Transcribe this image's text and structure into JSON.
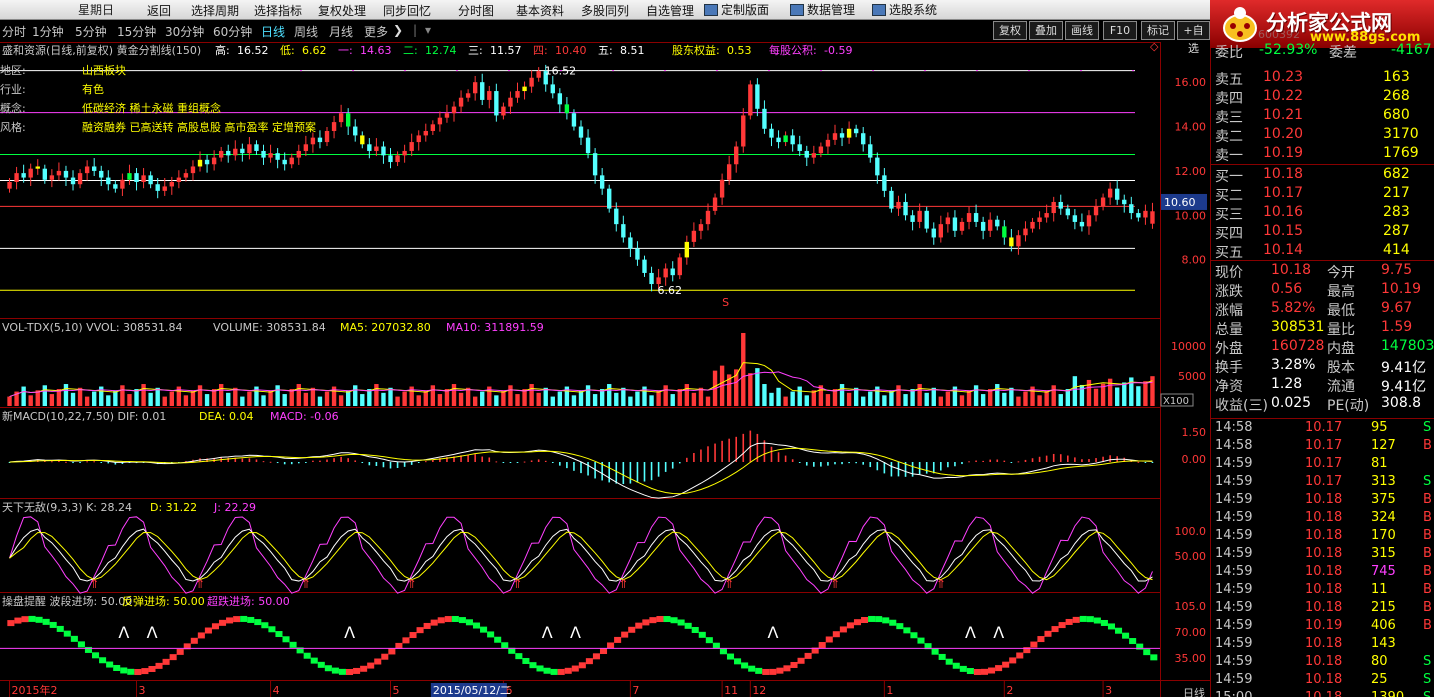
{
  "titlebar": {
    "weekday": "星期日",
    "items": [
      {
        "label": "定制版面",
        "icon": "layout-icon"
      },
      {
        "label": "数据管理",
        "icon": "database-icon"
      },
      {
        "label": "选股系统",
        "icon": "stock-picker-icon"
      }
    ]
  },
  "period_tabs": [
    "分时",
    "1分钟",
    "5分钟",
    "15分钟",
    "30分钟",
    "60分钟",
    "日线",
    "周线",
    "月线",
    "更多"
  ],
  "active_period": "日线",
  "menu": [
    "返回",
    "选择周期",
    "选择指标",
    "复权处理",
    "同步回忆",
    "分时图",
    "基本资料",
    "多股同列",
    "自选管理"
  ],
  "tools": [
    "复权",
    "叠加",
    "画线",
    "F10",
    "标记",
    "+自选"
  ],
  "logo": {
    "text": "分析家公式网",
    "url_text": "www.88gs.com",
    "code": "600392"
  },
  "colors": {
    "up": "#ff3838",
    "down": "#54ffff",
    "bg": "#000000",
    "accent": "#ffff00",
    "magenta": "#ff40ff"
  },
  "main": {
    "header_name": "盛和资源(日线,前复权) 黄金分割线(150)",
    "header_items": [
      {
        "label": "高:",
        "value": "16.52",
        "color": "#ffffff"
      },
      {
        "label": "低:",
        "value": "6.62",
        "color": "#ffff00"
      },
      {
        "label": "一:",
        "value": "14.63",
        "color": "#ff40ff"
      },
      {
        "label": "二:",
        "value": "12.74",
        "color": "#00ff40"
      },
      {
        "label": "三:",
        "value": "11.57",
        "color": "#ffffff"
      },
      {
        "label": "四:",
        "value": "10.40",
        "color": "#ff3838"
      },
      {
        "label": "五:",
        "value": "8.51",
        "color": "#ffffff"
      }
    ],
    "extra": [
      {
        "label": "股东权益:",
        "value": "0.53",
        "color": "#ffff00"
      },
      {
        "label": "每股公积:",
        "value": "-0.59",
        "color": "#ff40ff"
      }
    ],
    "info": [
      {
        "k": "地区:",
        "v": "山西板块"
      },
      {
        "k": "行业:",
        "v": "有色"
      },
      {
        "k": "概念:",
        "v": "低碳经济 稀土永磁 重组概念"
      },
      {
        "k": "风格:",
        "v": "融资融券 已高送转 高股息股 高市盈率 定增预案"
      }
    ],
    "hi_label": "16.52",
    "lo_label": "6.62",
    "s_mark": "S",
    "y_ticks": [
      "16.00",
      "14.00",
      "12.00",
      "10.00",
      "8.00"
    ],
    "price_tag": "10.60",
    "gold_lines": [
      16.52,
      14.63,
      12.74,
      11.57,
      10.4,
      8.51,
      6.62
    ]
  },
  "volume": {
    "header": [
      {
        "text": "VOL-TDX(5,10) VVOL: 308531.84",
        "color": "#c8c8c8"
      },
      {
        "text": "VOLUME: 308531.84",
        "color": "#c8c8c8"
      },
      {
        "text": "MA5: 207032.80",
        "color": "#ffff00"
      },
      {
        "text": "MA10: 311891.59",
        "color": "#ff40ff"
      }
    ],
    "y_ticks": [
      "10000",
      "5000"
    ],
    "unit": "X100"
  },
  "macd": {
    "header": [
      {
        "text": "新MACD(10,22,7.50) DIF: 0.01",
        "color": "#c8c8c8"
      },
      {
        "text": "DEA: 0.04",
        "color": "#ffff00"
      },
      {
        "text": "MACD: -0.06",
        "color": "#ff40ff"
      }
    ],
    "y_ticks": [
      "1.50",
      "0.00"
    ]
  },
  "kdj": {
    "header": [
      {
        "text": "天下无敌(9,3,3) K: 28.24",
        "color": "#c8c8c8"
      },
      {
        "text": "D: 31.22",
        "color": "#ffff00"
      },
      {
        "text": "J: 22.29",
        "color": "#ff40ff"
      }
    ],
    "y_ticks": [
      "100.0",
      "50.00"
    ]
  },
  "alert": {
    "header": [
      {
        "text": "操盘提醒 波段进场: 50.00",
        "color": "#c8c8c8"
      },
      {
        "text": "反弹进场: 50.00",
        "color": "#ffff00"
      },
      {
        "text": "超跌进场: 50.00",
        "color": "#ff40ff"
      }
    ],
    "y_ticks": [
      "105.0",
      "70.00",
      "35.00"
    ]
  },
  "x_axis": {
    "labels": [
      {
        "t": "2015年2",
        "i": 0
      },
      {
        "t": "3",
        "i": 18
      },
      {
        "t": "4",
        "i": 37
      },
      {
        "t": "5",
        "i": 54
      },
      {
        "t": "6",
        "i": 70
      },
      {
        "t": "7",
        "i": 88
      },
      {
        "t": "11",
        "i": 101
      },
      {
        "t": "12",
        "i": 105
      },
      {
        "t": "1",
        "i": 124
      },
      {
        "t": "2",
        "i": 141
      },
      {
        "t": "3",
        "i": 155
      }
    ],
    "cursor_date": "2015/05/12/二",
    "cursor_index": 60
  },
  "quote": {
    "weibi": {
      "label": "委比",
      "value": "-52.93%",
      "label2": "委差",
      "value2": "-4167"
    },
    "sell": [
      {
        "label": "卖五",
        "price": "10.23",
        "vol": "163"
      },
      {
        "label": "卖四",
        "price": "10.22",
        "vol": "268"
      },
      {
        "label": "卖三",
        "price": "10.21",
        "vol": "680"
      },
      {
        "label": "卖二",
        "price": "10.20",
        "vol": "3170"
      },
      {
        "label": "卖一",
        "price": "10.19",
        "vol": "1769"
      }
    ],
    "buy": [
      {
        "label": "买一",
        "price": "10.18",
        "vol": "682"
      },
      {
        "label": "买二",
        "price": "10.17",
        "vol": "217"
      },
      {
        "label": "买三",
        "price": "10.16",
        "vol": "283"
      },
      {
        "label": "买四",
        "price": "10.15",
        "vol": "287"
      },
      {
        "label": "买五",
        "price": "10.14",
        "vol": "414"
      }
    ],
    "stats": [
      {
        "l1": "现价",
        "v1": "10.18",
        "c1": "#ff3838",
        "l2": "今开",
        "v2": "9.75",
        "c2": "#ff3838"
      },
      {
        "l1": "涨跌",
        "v1": "0.56",
        "c1": "#ff3838",
        "l2": "最高",
        "v2": "10.19",
        "c2": "#ff3838"
      },
      {
        "l1": "涨幅",
        "v1": "5.82%",
        "c1": "#ff3838",
        "l2": "最低",
        "v2": "9.67",
        "c2": "#ff3838"
      },
      {
        "l1": "总量",
        "v1": "308531",
        "c1": "#ffff00",
        "l2": "量比",
        "v2": "1.59",
        "c2": "#ff3838"
      },
      {
        "l1": "外盘",
        "v1": "160728",
        "c1": "#ff3838",
        "l2": "内盘",
        "v2": "147803",
        "c2": "#00ff40"
      },
      {
        "l1": "换手",
        "v1": "3.28%",
        "c1": "#ffffff",
        "l2": "股本",
        "v2": "9.41亿",
        "c2": "#ffffff"
      },
      {
        "l1": "净资",
        "v1": "1.28",
        "c1": "#ffffff",
        "l2": "流通",
        "v2": "9.41亿",
        "c2": "#ffffff"
      },
      {
        "l1": "收益(三)",
        "v1": "0.025",
        "c1": "#ffffff",
        "l2": "PE(动)",
        "v2": "308.8",
        "c2": "#ffffff"
      }
    ],
    "ticks": [
      {
        "t": "14:58",
        "p": "10.17",
        "v": "95",
        "bs": "S"
      },
      {
        "t": "14:58",
        "p": "10.17",
        "v": "127",
        "bs": "B"
      },
      {
        "t": "14:59",
        "p": "10.17",
        "v": "81",
        "bs": ""
      },
      {
        "t": "14:59",
        "p": "10.17",
        "v": "313",
        "bs": "S"
      },
      {
        "t": "14:59",
        "p": "10.18",
        "v": "375",
        "bs": "B"
      },
      {
        "t": "14:59",
        "p": "10.18",
        "v": "324",
        "bs": "B"
      },
      {
        "t": "14:59",
        "p": "10.18",
        "v": "170",
        "bs": "B"
      },
      {
        "t": "14:59",
        "p": "10.18",
        "v": "315",
        "bs": "B"
      },
      {
        "t": "14:59",
        "p": "10.18",
        "v": "745",
        "bs": "B"
      },
      {
        "t": "14:59",
        "p": "10.18",
        "v": "11",
        "bs": "B"
      },
      {
        "t": "14:59",
        "p": "10.18",
        "v": "215",
        "bs": "B"
      },
      {
        "t": "14:59",
        "p": "10.19",
        "v": "406",
        "bs": "B"
      },
      {
        "t": "14:59",
        "p": "10.18",
        "v": "143",
        "bs": ""
      },
      {
        "t": "14:59",
        "p": "10.18",
        "v": "80",
        "bs": "S"
      },
      {
        "t": "14:59",
        "p": "10.18",
        "v": "25",
        "bs": "S"
      },
      {
        "t": "15:00",
        "p": "10.18",
        "v": "1390",
        "bs": "S"
      }
    ],
    "bottom": "日线"
  },
  "chart_data": {
    "type": "candlestick",
    "closes": [
      11.5,
      11.9,
      11.7,
      12.1,
      12.2,
      11.6,
      11.8,
      12.0,
      11.7,
      11.4,
      11.9,
      12.2,
      12.0,
      11.7,
      11.4,
      11.2,
      11.6,
      11.9,
      11.5,
      11.8,
      11.4,
      11.1,
      11.3,
      11.5,
      11.7,
      11.9,
      12.2,
      12.5,
      12.3,
      12.6,
      12.9,
      12.7,
      13.0,
      12.8,
      13.2,
      12.9,
      12.6,
      12.8,
      12.5,
      12.3,
      12.6,
      12.9,
      13.2,
      13.5,
      13.3,
      13.8,
      14.2,
      14.6,
      14.0,
      13.6,
      13.2,
      12.9,
      13.1,
      12.7,
      12.4,
      12.7,
      12.9,
      13.3,
      13.6,
      13.8,
      14.1,
      14.4,
      14.6,
      14.9,
      15.3,
      15.5,
      16.0,
      15.2,
      15.6,
      14.5,
      14.9,
      15.3,
      15.6,
      15.8,
      16.2,
      16.5,
      15.9,
      15.5,
      15.0,
      14.6,
      14.0,
      13.5,
      12.8,
      11.8,
      11.2,
      10.3,
      9.6,
      9.0,
      8.5,
      8.0,
      7.4,
      6.9,
      7.2,
      7.6,
      7.3,
      8.1,
      8.8,
      9.3,
      9.6,
      10.2,
      10.8,
      11.6,
      12.3,
      13.1,
      14.5,
      15.9,
      14.8,
      13.9,
      13.5,
      13.3,
      13.6,
      13.2,
      12.9,
      12.6,
      12.8,
      13.1,
      13.4,
      13.7,
      13.5,
      13.9,
      13.7,
      13.2,
      12.6,
      11.8,
      11.1,
      10.3,
      10.6,
      10.0,
      9.7,
      10.2,
      9.4,
      9.0,
      9.6,
      9.9,
      9.3,
      9.7,
      10.1,
      9.7,
      9.3,
      9.8,
      9.5,
      9.0,
      8.6,
      9.1,
      9.4,
      9.7,
      9.9,
      10.1,
      10.6,
      10.3,
      10.0,
      9.7,
      9.5,
      10.0,
      10.4,
      10.8,
      11.2,
      10.7,
      10.5,
      10.1,
      9.9,
      10.2,
      10.18
    ],
    "opens": [
      11.2,
      11.5,
      11.9,
      11.7,
      12.1,
      12.1,
      11.6,
      11.8,
      12.0,
      11.7,
      11.4,
      11.9,
      12.2,
      12.0,
      11.7,
      11.4,
      11.2,
      11.6,
      11.9,
      11.5,
      11.8,
      11.4,
      11.1,
      11.3,
      11.5,
      11.7,
      11.9,
      12.2,
      12.5,
      12.3,
      12.6,
      12.9,
      12.7,
      13.0,
      12.8,
      13.2,
      12.9,
      12.6,
      12.8,
      12.5,
      12.3,
      12.6,
      12.9,
      13.2,
      13.5,
      13.3,
      13.8,
      14.2,
      14.6,
      14.0,
      13.6,
      13.2,
      12.9,
      13.1,
      12.7,
      12.4,
      12.7,
      12.9,
      13.3,
      13.6,
      13.8,
      14.1,
      14.4,
      14.6,
      14.9,
      15.3,
      15.5,
      16.0,
      15.2,
      15.6,
      14.5,
      14.9,
      15.3,
      15.6,
      15.8,
      16.2,
      16.5,
      15.9,
      15.5,
      15.0,
      14.6,
      14.0,
      13.5,
      12.8,
      11.8,
      11.2,
      10.3,
      9.6,
      9.0,
      8.5,
      8.0,
      7.4,
      6.9,
      7.2,
      7.6,
      7.3,
      8.1,
      8.8,
      9.3,
      9.6,
      10.2,
      10.8,
      11.6,
      12.3,
      13.1,
      14.5,
      15.9,
      14.8,
      13.9,
      13.5,
      13.3,
      13.6,
      13.2,
      12.9,
      12.6,
      12.8,
      13.1,
      13.4,
      13.7,
      13.5,
      13.9,
      13.7,
      13.2,
      12.6,
      11.8,
      11.1,
      10.3,
      10.6,
      10.0,
      9.7,
      10.2,
      9.4,
      9.0,
      9.6,
      9.9,
      9.3,
      9.7,
      10.1,
      9.7,
      9.3,
      9.8,
      9.5,
      9.0,
      8.6,
      9.1,
      9.4,
      9.7,
      9.9,
      10.1,
      10.6,
      10.3,
      10.0,
      9.7,
      9.5,
      10.0,
      10.4,
      10.8,
      11.2,
      10.7,
      10.5,
      10.1,
      9.9,
      9.62
    ],
    "y_range": [
      6.0,
      17.0
    ],
    "volume_range": [
      0,
      13000
    ],
    "x_label": "",
    "y_label": ""
  }
}
